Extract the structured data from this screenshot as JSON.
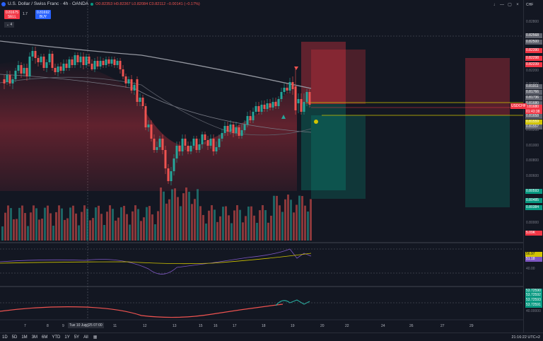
{
  "legend": {
    "symbol": "U.S. Dollar / Swiss Franc · 4h · OANDA",
    "ohlc": "O0.82353 H0.82367 L0.82084 C0.82112 −0.00141 (−0.17%)"
  },
  "trade": {
    "sell_price": "0.81675",
    "sell_label": "SELL",
    "spread": "1.7",
    "buy_price": "0.81692",
    "buy_label": "BUY",
    "indicator_count": "4"
  },
  "price_scale": {
    "currency": "CHF",
    "grid_labels": [
      "0.82800",
      "0.82200",
      "0.81800",
      "0.81600",
      "0.81400",
      "0.81200",
      "0.81000",
      "0.80800",
      "0.80600",
      "0.80400",
      "0.80200",
      "0.80000"
    ],
    "tags": [
      {
        "text": "0.82568",
        "color": "#5d606b"
      },
      {
        "text": "0.82500",
        "color": "#5d606b"
      },
      {
        "text": "0.82390",
        "color": "#f23645"
      },
      {
        "text": "0.82298",
        "color": "#f23645"
      },
      {
        "text": "0.82239",
        "color": "#f23645"
      },
      {
        "text": "0.81911",
        "color": "#5d606b"
      },
      {
        "text": "0.81766",
        "color": "#5d606b"
      },
      {
        "text": "0.81736",
        "color": "#5d606b"
      },
      {
        "text": "0.81680",
        "color": "#5d606b"
      },
      {
        "text": "0.81680",
        "color": "#f23645"
      },
      {
        "text": "01:43:38",
        "color": "#f23645"
      },
      {
        "text": "0.81658",
        "color": "#5d606b"
      },
      {
        "text": "0.81559",
        "color": "#d1c400"
      },
      {
        "text": "0.81557",
        "color": "#5d606b"
      },
      {
        "text": "0.80593",
        "color": "#089981"
      },
      {
        "text": "0.80485",
        "color": "#089981"
      },
      {
        "text": "0.80384",
        "color": "#089981"
      },
      {
        "text": "5.09K",
        "color": "#f23645"
      }
    ],
    "symbol_tag": "USDCHF",
    "rsi_labels": [
      "56.97",
      "51.18",
      "40.00"
    ],
    "osc_labels": [
      "53.72590",
      "53.72592",
      "53.72593",
      "53.72591",
      "40.00000"
    ]
  },
  "time_axis": {
    "labels": [
      "7",
      "8",
      "9",
      "10",
      "11",
      "12",
      "13",
      "15",
      "16",
      "17",
      "18",
      "19",
      "20",
      "22",
      "24",
      "26",
      "27",
      "29"
    ],
    "highlight": "Tue 10 Jun '25   07:00"
  },
  "bottom_bar": {
    "timeframes": [
      "1D",
      "5D",
      "1M",
      "3M",
      "6M",
      "YTD",
      "1Y",
      "5Y",
      "All"
    ],
    "clock": "21:16:22 UTC+2"
  },
  "colors": {
    "bull": "#26a69a",
    "bear": "#ef5350",
    "background": "#131722",
    "accent": "#2962ff"
  }
}
